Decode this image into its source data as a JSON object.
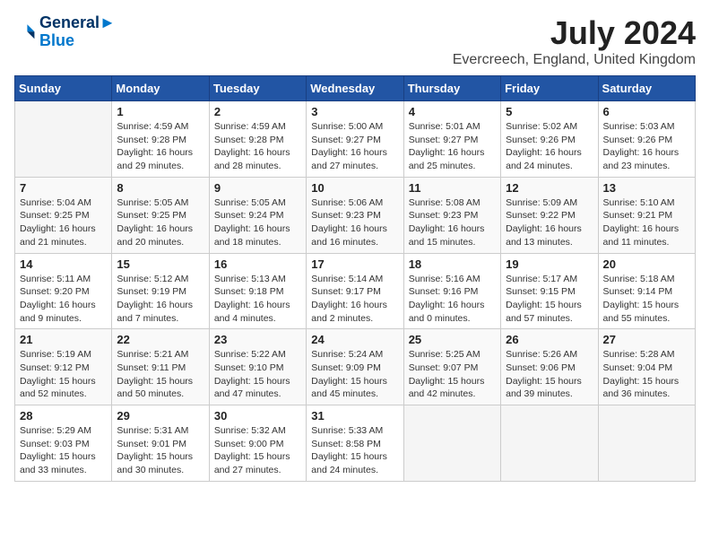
{
  "logo": {
    "line1": "General",
    "line2": "Blue"
  },
  "title": {
    "month_year": "July 2024",
    "location": "Evercreech, England, United Kingdom"
  },
  "days_of_week": [
    "Sunday",
    "Monday",
    "Tuesday",
    "Wednesday",
    "Thursday",
    "Friday",
    "Saturday"
  ],
  "weeks": [
    [
      {
        "day": "",
        "info": ""
      },
      {
        "day": "1",
        "info": "Sunrise: 4:59 AM\nSunset: 9:28 PM\nDaylight: 16 hours\nand 29 minutes."
      },
      {
        "day": "2",
        "info": "Sunrise: 4:59 AM\nSunset: 9:28 PM\nDaylight: 16 hours\nand 28 minutes."
      },
      {
        "day": "3",
        "info": "Sunrise: 5:00 AM\nSunset: 9:27 PM\nDaylight: 16 hours\nand 27 minutes."
      },
      {
        "day": "4",
        "info": "Sunrise: 5:01 AM\nSunset: 9:27 PM\nDaylight: 16 hours\nand 25 minutes."
      },
      {
        "day": "5",
        "info": "Sunrise: 5:02 AM\nSunset: 9:26 PM\nDaylight: 16 hours\nand 24 minutes."
      },
      {
        "day": "6",
        "info": "Sunrise: 5:03 AM\nSunset: 9:26 PM\nDaylight: 16 hours\nand 23 minutes."
      }
    ],
    [
      {
        "day": "7",
        "info": "Sunrise: 5:04 AM\nSunset: 9:25 PM\nDaylight: 16 hours\nand 21 minutes."
      },
      {
        "day": "8",
        "info": "Sunrise: 5:05 AM\nSunset: 9:25 PM\nDaylight: 16 hours\nand 20 minutes."
      },
      {
        "day": "9",
        "info": "Sunrise: 5:05 AM\nSunset: 9:24 PM\nDaylight: 16 hours\nand 18 minutes."
      },
      {
        "day": "10",
        "info": "Sunrise: 5:06 AM\nSunset: 9:23 PM\nDaylight: 16 hours\nand 16 minutes."
      },
      {
        "day": "11",
        "info": "Sunrise: 5:08 AM\nSunset: 9:23 PM\nDaylight: 16 hours\nand 15 minutes."
      },
      {
        "day": "12",
        "info": "Sunrise: 5:09 AM\nSunset: 9:22 PM\nDaylight: 16 hours\nand 13 minutes."
      },
      {
        "day": "13",
        "info": "Sunrise: 5:10 AM\nSunset: 9:21 PM\nDaylight: 16 hours\nand 11 minutes."
      }
    ],
    [
      {
        "day": "14",
        "info": "Sunrise: 5:11 AM\nSunset: 9:20 PM\nDaylight: 16 hours\nand 9 minutes."
      },
      {
        "day": "15",
        "info": "Sunrise: 5:12 AM\nSunset: 9:19 PM\nDaylight: 16 hours\nand 7 minutes."
      },
      {
        "day": "16",
        "info": "Sunrise: 5:13 AM\nSunset: 9:18 PM\nDaylight: 16 hours\nand 4 minutes."
      },
      {
        "day": "17",
        "info": "Sunrise: 5:14 AM\nSunset: 9:17 PM\nDaylight: 16 hours\nand 2 minutes."
      },
      {
        "day": "18",
        "info": "Sunrise: 5:16 AM\nSunset: 9:16 PM\nDaylight: 16 hours\nand 0 minutes."
      },
      {
        "day": "19",
        "info": "Sunrise: 5:17 AM\nSunset: 9:15 PM\nDaylight: 15 hours\nand 57 minutes."
      },
      {
        "day": "20",
        "info": "Sunrise: 5:18 AM\nSunset: 9:14 PM\nDaylight: 15 hours\nand 55 minutes."
      }
    ],
    [
      {
        "day": "21",
        "info": "Sunrise: 5:19 AM\nSunset: 9:12 PM\nDaylight: 15 hours\nand 52 minutes."
      },
      {
        "day": "22",
        "info": "Sunrise: 5:21 AM\nSunset: 9:11 PM\nDaylight: 15 hours\nand 50 minutes."
      },
      {
        "day": "23",
        "info": "Sunrise: 5:22 AM\nSunset: 9:10 PM\nDaylight: 15 hours\nand 47 minutes."
      },
      {
        "day": "24",
        "info": "Sunrise: 5:24 AM\nSunset: 9:09 PM\nDaylight: 15 hours\nand 45 minutes."
      },
      {
        "day": "25",
        "info": "Sunrise: 5:25 AM\nSunset: 9:07 PM\nDaylight: 15 hours\nand 42 minutes."
      },
      {
        "day": "26",
        "info": "Sunrise: 5:26 AM\nSunset: 9:06 PM\nDaylight: 15 hours\nand 39 minutes."
      },
      {
        "day": "27",
        "info": "Sunrise: 5:28 AM\nSunset: 9:04 PM\nDaylight: 15 hours\nand 36 minutes."
      }
    ],
    [
      {
        "day": "28",
        "info": "Sunrise: 5:29 AM\nSunset: 9:03 PM\nDaylight: 15 hours\nand 33 minutes."
      },
      {
        "day": "29",
        "info": "Sunrise: 5:31 AM\nSunset: 9:01 PM\nDaylight: 15 hours\nand 30 minutes."
      },
      {
        "day": "30",
        "info": "Sunrise: 5:32 AM\nSunset: 9:00 PM\nDaylight: 15 hours\nand 27 minutes."
      },
      {
        "day": "31",
        "info": "Sunrise: 5:33 AM\nSunset: 8:58 PM\nDaylight: 15 hours\nand 24 minutes."
      },
      {
        "day": "",
        "info": ""
      },
      {
        "day": "",
        "info": ""
      },
      {
        "day": "",
        "info": ""
      }
    ]
  ]
}
